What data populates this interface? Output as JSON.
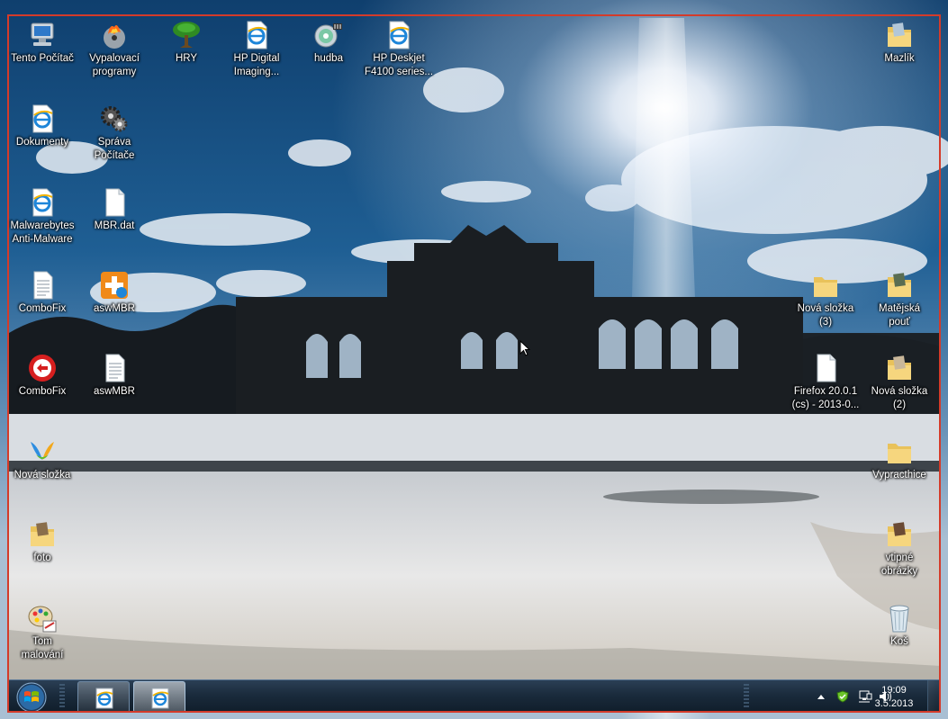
{
  "desktop": {
    "icons": [
      {
        "id": "tento-pocitac",
        "label": "Tento Počítač",
        "icon": "computer-icon"
      },
      {
        "id": "vypalovaci-programy",
        "label": "Vypalovací\nprogramy",
        "icon": "burning-disc-icon"
      },
      {
        "id": "hry",
        "label": "HRY",
        "icon": "tree-icon"
      },
      {
        "id": "hp-digital-imaging",
        "label": "HP Digital\nImaging...",
        "icon": "ie-shortcut-icon"
      },
      {
        "id": "hudba",
        "label": "hudba",
        "icon": "music-cd-icon"
      },
      {
        "id": "hp-deskjet",
        "label": "HP Deskjet\nF4100 series...",
        "icon": "ie-shortcut-icon"
      },
      {
        "id": "mazlik",
        "label": "Mazlík",
        "icon": "folder-icon"
      },
      {
        "id": "dokumenty",
        "label": "Dokumenty",
        "icon": "ie-shortcut-icon"
      },
      {
        "id": "sprava-pocitace",
        "label": "Správa\nPočítače",
        "icon": "gears-icon"
      },
      {
        "id": "malwarebytes",
        "label": "Malwarebytes\nAnti-Malware",
        "icon": "ie-shortcut-icon"
      },
      {
        "id": "mbr-dat",
        "label": "MBR.dat",
        "icon": "blank-file-icon"
      },
      {
        "id": "combofix-txt",
        "label": "ComboFix",
        "icon": "text-file-icon"
      },
      {
        "id": "aswmbr-exe",
        "label": "aswMBR",
        "icon": "avast-icon"
      },
      {
        "id": "nova-slozka-3",
        "label": "Nová složka\n(3)",
        "icon": "folder-icon"
      },
      {
        "id": "matejska-pout",
        "label": "Matějská\npouť",
        "icon": "folder-icon"
      },
      {
        "id": "combofix-exe",
        "label": "ComboFix",
        "icon": "combofix-icon"
      },
      {
        "id": "aswmbr-txt",
        "label": "aswMBR",
        "icon": "text-file-icon"
      },
      {
        "id": "firefox-installer",
        "label": "Firefox 20.0.1\n(cs) - 2013-0...",
        "icon": "blank-file-icon"
      },
      {
        "id": "nova-slozka-2",
        "label": "Nová složka\n(2)",
        "icon": "folder-icon"
      },
      {
        "id": "nova-slozka",
        "label": "Nová složka",
        "icon": "messenger-icon"
      },
      {
        "id": "vypracheno",
        "label": "Vypracthice",
        "icon": "folder-icon"
      },
      {
        "id": "foto",
        "label": "foto",
        "icon": "folder-icon"
      },
      {
        "id": "vtipne-obrazky",
        "label": "vtipné\nobrázky",
        "icon": "folder-icon"
      },
      {
        "id": "tom-malovani",
        "label": "Tom\nmalování",
        "icon": "paint-icon"
      },
      {
        "id": "kos",
        "label": "Koš",
        "icon": "recycle-bin-icon"
      }
    ]
  },
  "taskbar": {
    "start_icon": "windows-orb-icon",
    "buttons": [
      {
        "icon": "internet-explorer-icon",
        "active": false
      },
      {
        "icon": "internet-explorer-icon",
        "active": true
      }
    ],
    "tray": {
      "icons": [
        "show-hidden-icons-icon",
        "security-shield-icon",
        "network-icon",
        "volume-icon"
      ],
      "time": "19:09",
      "date": "3.5.2013"
    }
  },
  "colors": {
    "frame": "#d43b2a",
    "taskbar": "#1a2b3c"
  }
}
